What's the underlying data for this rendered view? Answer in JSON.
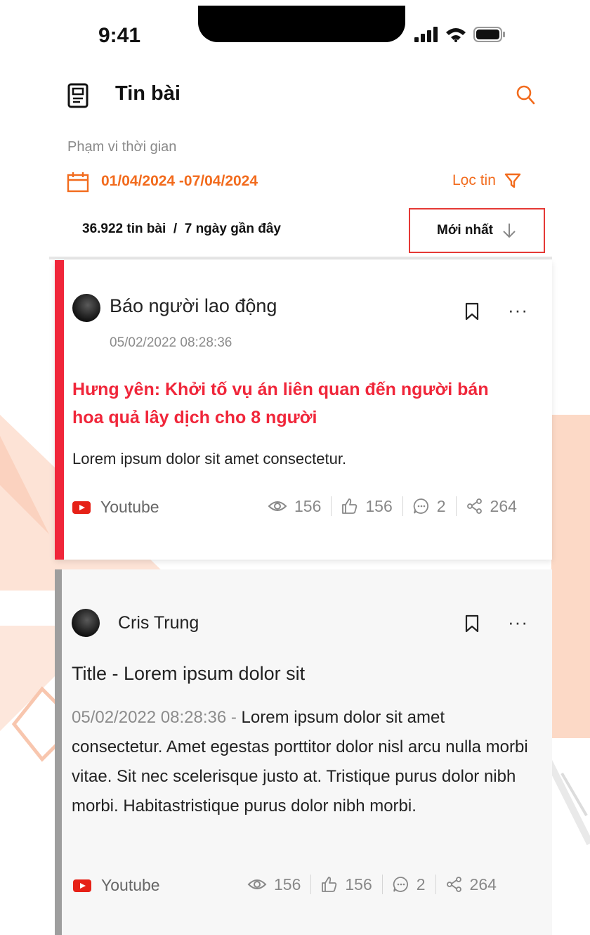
{
  "status_bar": {
    "time": "9:41"
  },
  "header": {
    "title": "Tin bài"
  },
  "range": {
    "label": "Phạm vi thời gian",
    "value": "01/04/2024 -07/04/2024"
  },
  "filter": {
    "label": "Lọc tin"
  },
  "stats": {
    "text": "36.922 tin bài  /  7 ngày gần đây"
  },
  "sort": {
    "label": "Mới nhất"
  },
  "posts": [
    {
      "source": "Báo người lao động",
      "date": "05/02/2022 08:28:36",
      "headline": "Hưng yên: Khởi tố vụ án liên quan đến người bán hoa quả lây dịch cho 8 người",
      "summary": "Lorem ipsum dolor sit amet consectetur.",
      "platform": "Youtube",
      "views": "156",
      "likes": "156",
      "comments": "2",
      "shares": "264"
    },
    {
      "source": "Cris Trung",
      "title": "Title - Lorem ipsum dolor sit",
      "date": "05/02/2022 08:28:36 - ",
      "body": "Lorem ipsum dolor sit amet consectetur. Amet egestas porttitor dolor nisl arcu nulla morbi vitae. Sit nec scelerisque justo at. Tristique purus dolor nibh morbi. Habitastristique purus dolor nibh morbi.",
      "platform": "Youtube",
      "views": "156",
      "likes": "156",
      "comments": "2",
      "shares": "264"
    }
  ],
  "colors": {
    "accent": "#f26b1d",
    "headline_red": "#f0263a",
    "youtube_red": "#e62117"
  },
  "icons": [
    "document-icon",
    "search-icon",
    "calendar-icon",
    "filter-icon",
    "arrow-down-icon",
    "bookmark-icon",
    "more-icon",
    "youtube-icon",
    "eye-icon",
    "thumbs-up-icon",
    "comment-icon",
    "share-icon"
  ]
}
